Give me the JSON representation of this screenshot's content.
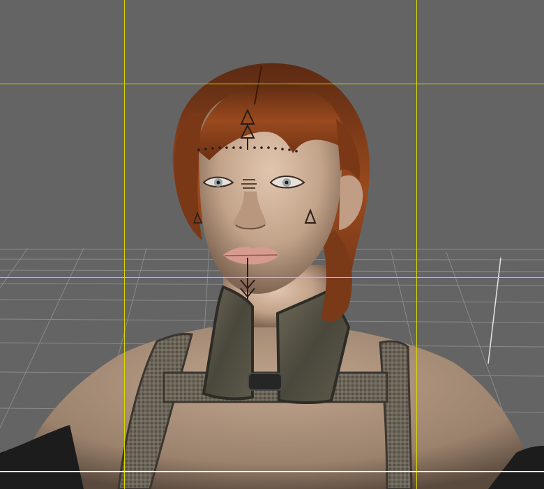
{
  "viewport": {
    "background_color": "#646464",
    "guide_color": "#d8d800",
    "grid_color": "#8a8a8a",
    "frame_line_color": "#f4f4f4"
  },
  "figure": {
    "hair_color": "#8a3e18",
    "skin_color": "#c9a98f",
    "armor_color": "#5a5648",
    "lip_color": "#d79a8f",
    "tattoo_color": "#2a1c18",
    "eye_color": "#9aa6a6"
  }
}
